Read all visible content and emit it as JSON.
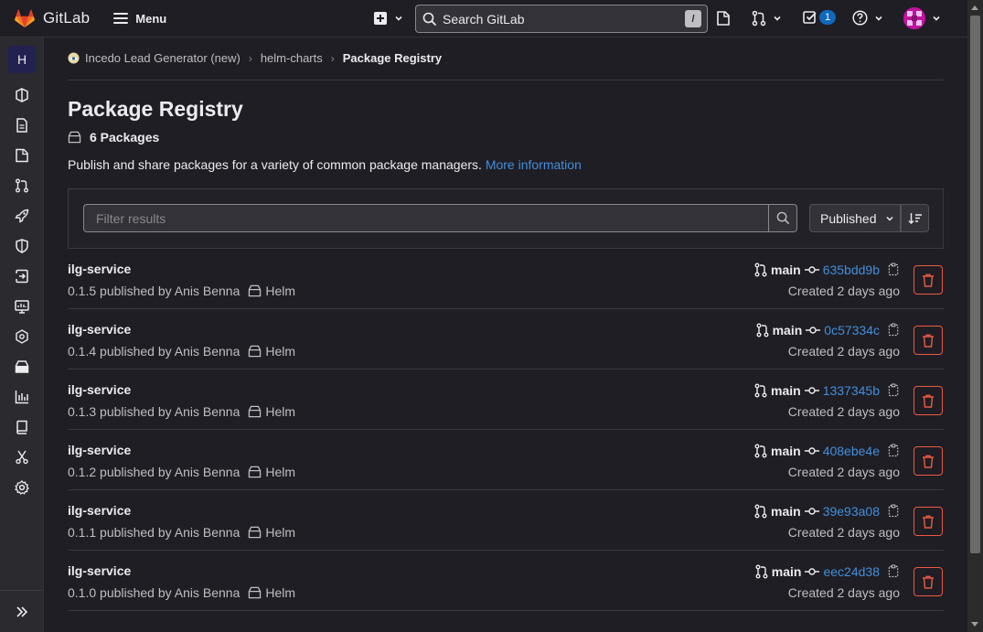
{
  "topbar": {
    "app_name": "GitLab",
    "menu_label": "Menu",
    "search_placeholder": "Search GitLab",
    "search_shortcut": "/",
    "todos_count": "1"
  },
  "sidebar": {
    "project_initial": "H",
    "items": [
      "project-overview-icon",
      "repository-icon",
      "issues-icon",
      "merge-requests-icon",
      "ci-cd-icon",
      "security-icon",
      "deployments-icon",
      "monitor-icon",
      "infrastructure-icon",
      "packages-icon",
      "analytics-icon",
      "wiki-icon",
      "snippets-icon",
      "settings-icon"
    ]
  },
  "breadcrumb": {
    "group": "Incedo Lead Generator (new)",
    "project": "helm-charts",
    "current": "Package Registry"
  },
  "page": {
    "title": "Package Registry",
    "package_count": "6 Packages",
    "description": "Publish and share packages for a variety of common package managers.",
    "more_info": "More information"
  },
  "filter": {
    "placeholder": "Filter results",
    "sort_label": "Published"
  },
  "packages": [
    {
      "name": "ilg-service",
      "meta": "0.1.5 published by Anis Benna",
      "type": "Helm",
      "branch": "main",
      "commit": "635bdd9b",
      "created": "Created 2 days ago"
    },
    {
      "name": "ilg-service",
      "meta": "0.1.4 published by Anis Benna",
      "type": "Helm",
      "branch": "main",
      "commit": "0c57334c",
      "created": "Created 2 days ago"
    },
    {
      "name": "ilg-service",
      "meta": "0.1.3 published by Anis Benna",
      "type": "Helm",
      "branch": "main",
      "commit": "1337345b",
      "created": "Created 2 days ago"
    },
    {
      "name": "ilg-service",
      "meta": "0.1.2 published by Anis Benna",
      "type": "Helm",
      "branch": "main",
      "commit": "408ebe4e",
      "created": "Created 2 days ago"
    },
    {
      "name": "ilg-service",
      "meta": "0.1.1 published by Anis Benna",
      "type": "Helm",
      "branch": "main",
      "commit": "39e93a08",
      "created": "Created 2 days ago"
    },
    {
      "name": "ilg-service",
      "meta": "0.1.0 published by Anis Benna",
      "type": "Helm",
      "branch": "main",
      "commit": "eec24d38",
      "created": "Created 2 days ago"
    }
  ],
  "colors": {
    "background": "#1f1e24",
    "link": "#428fdc",
    "danger": "#ec5941",
    "badge": "#1068bf"
  }
}
